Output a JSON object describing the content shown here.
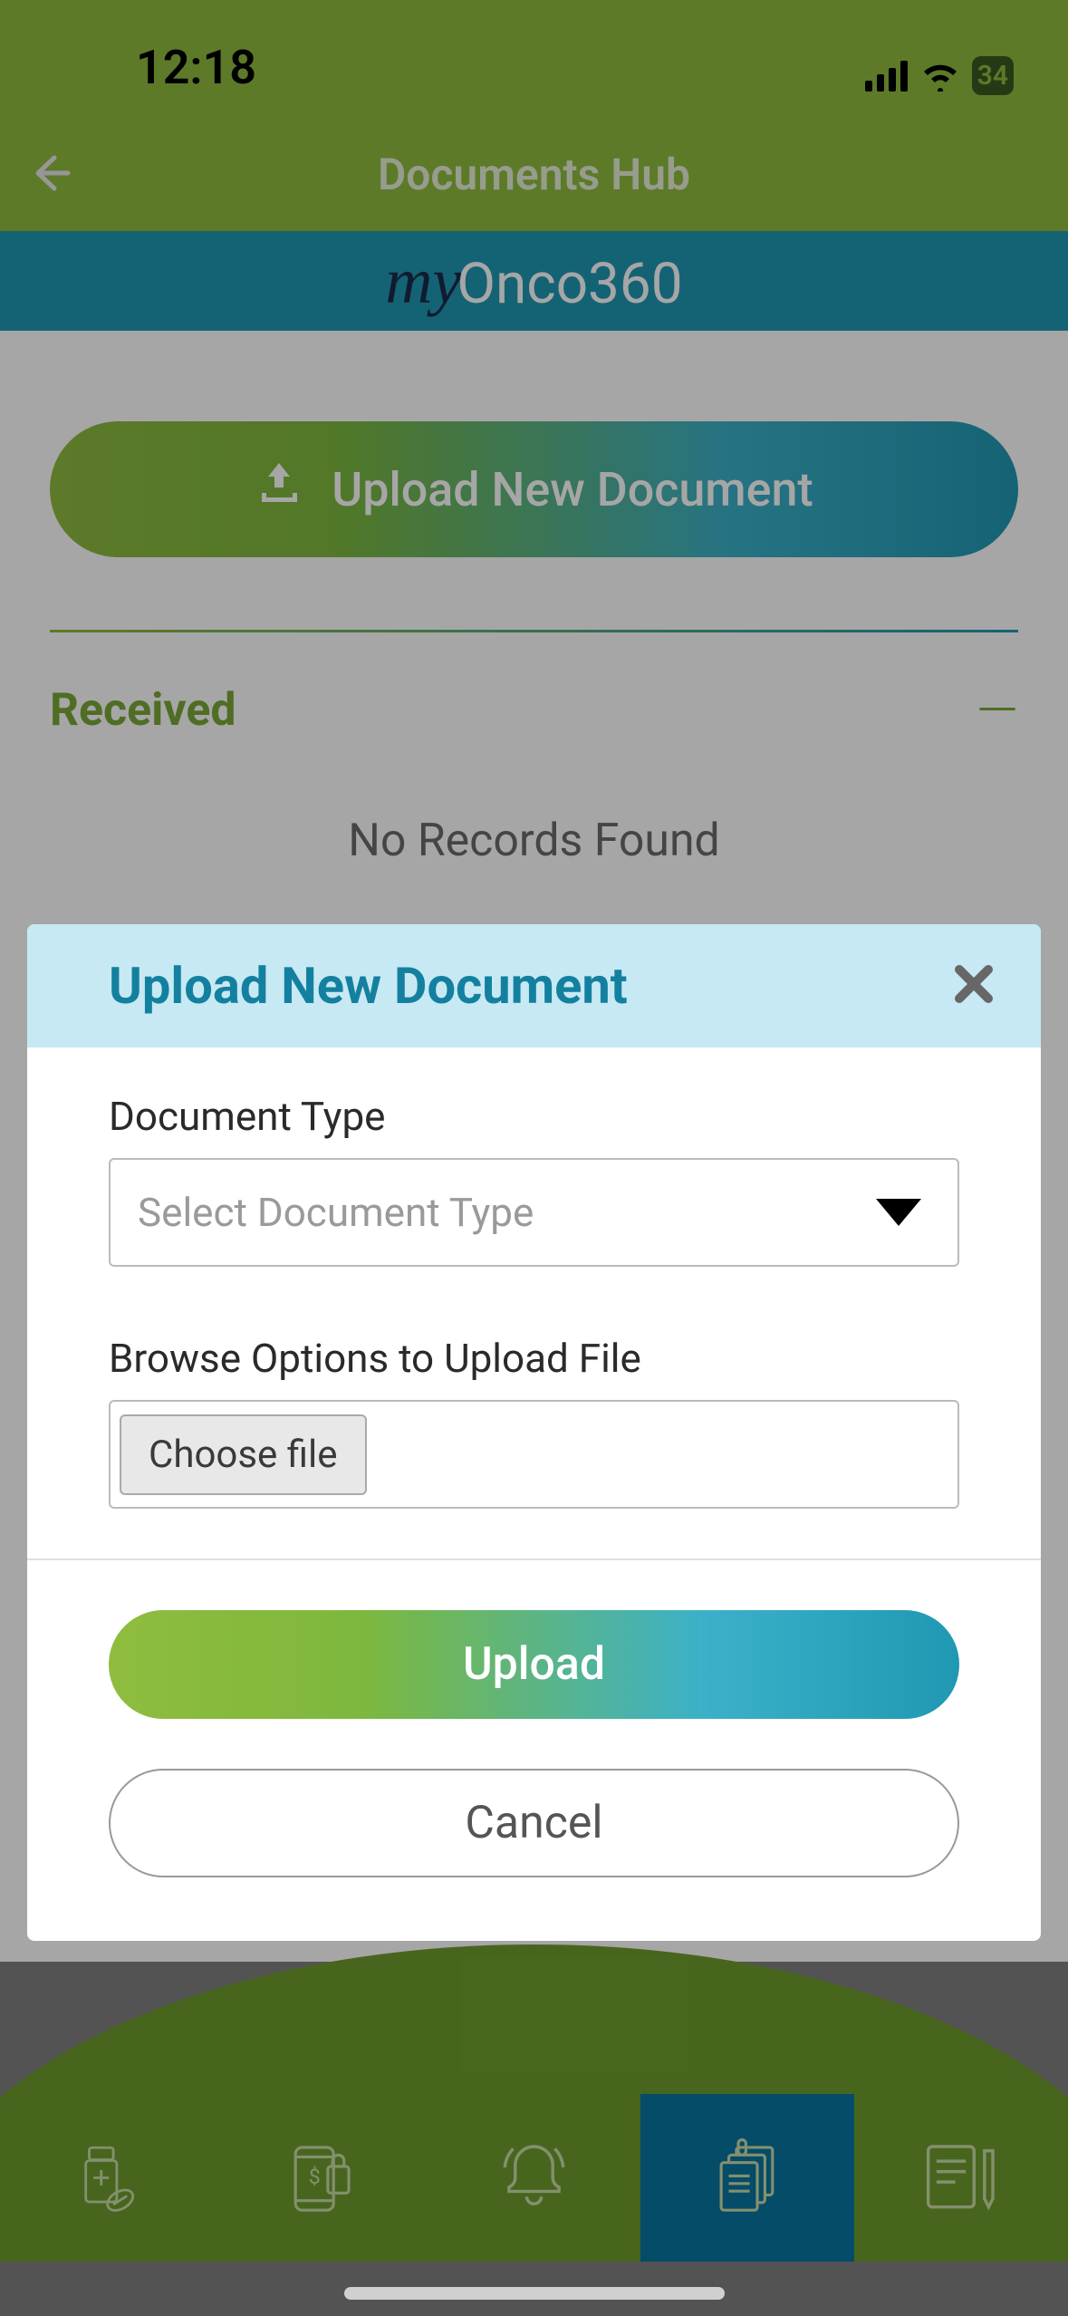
{
  "status": {
    "time": "12:18",
    "battery": "34"
  },
  "header": {
    "title": "Documents Hub"
  },
  "brand": {
    "my": "my",
    "onco": "Onco360"
  },
  "main": {
    "upload_button": "Upload New Document",
    "section_title": "Received",
    "empty_state": "No Records Found"
  },
  "modal": {
    "title": "Upload New Document",
    "field_doc_type_label": "Document Type",
    "doc_type_placeholder": "Select Document Type",
    "field_browse_label": "Browse Options to Upload File",
    "choose_file": "Choose file",
    "upload_button": "Upload",
    "cancel_button": "Cancel"
  }
}
